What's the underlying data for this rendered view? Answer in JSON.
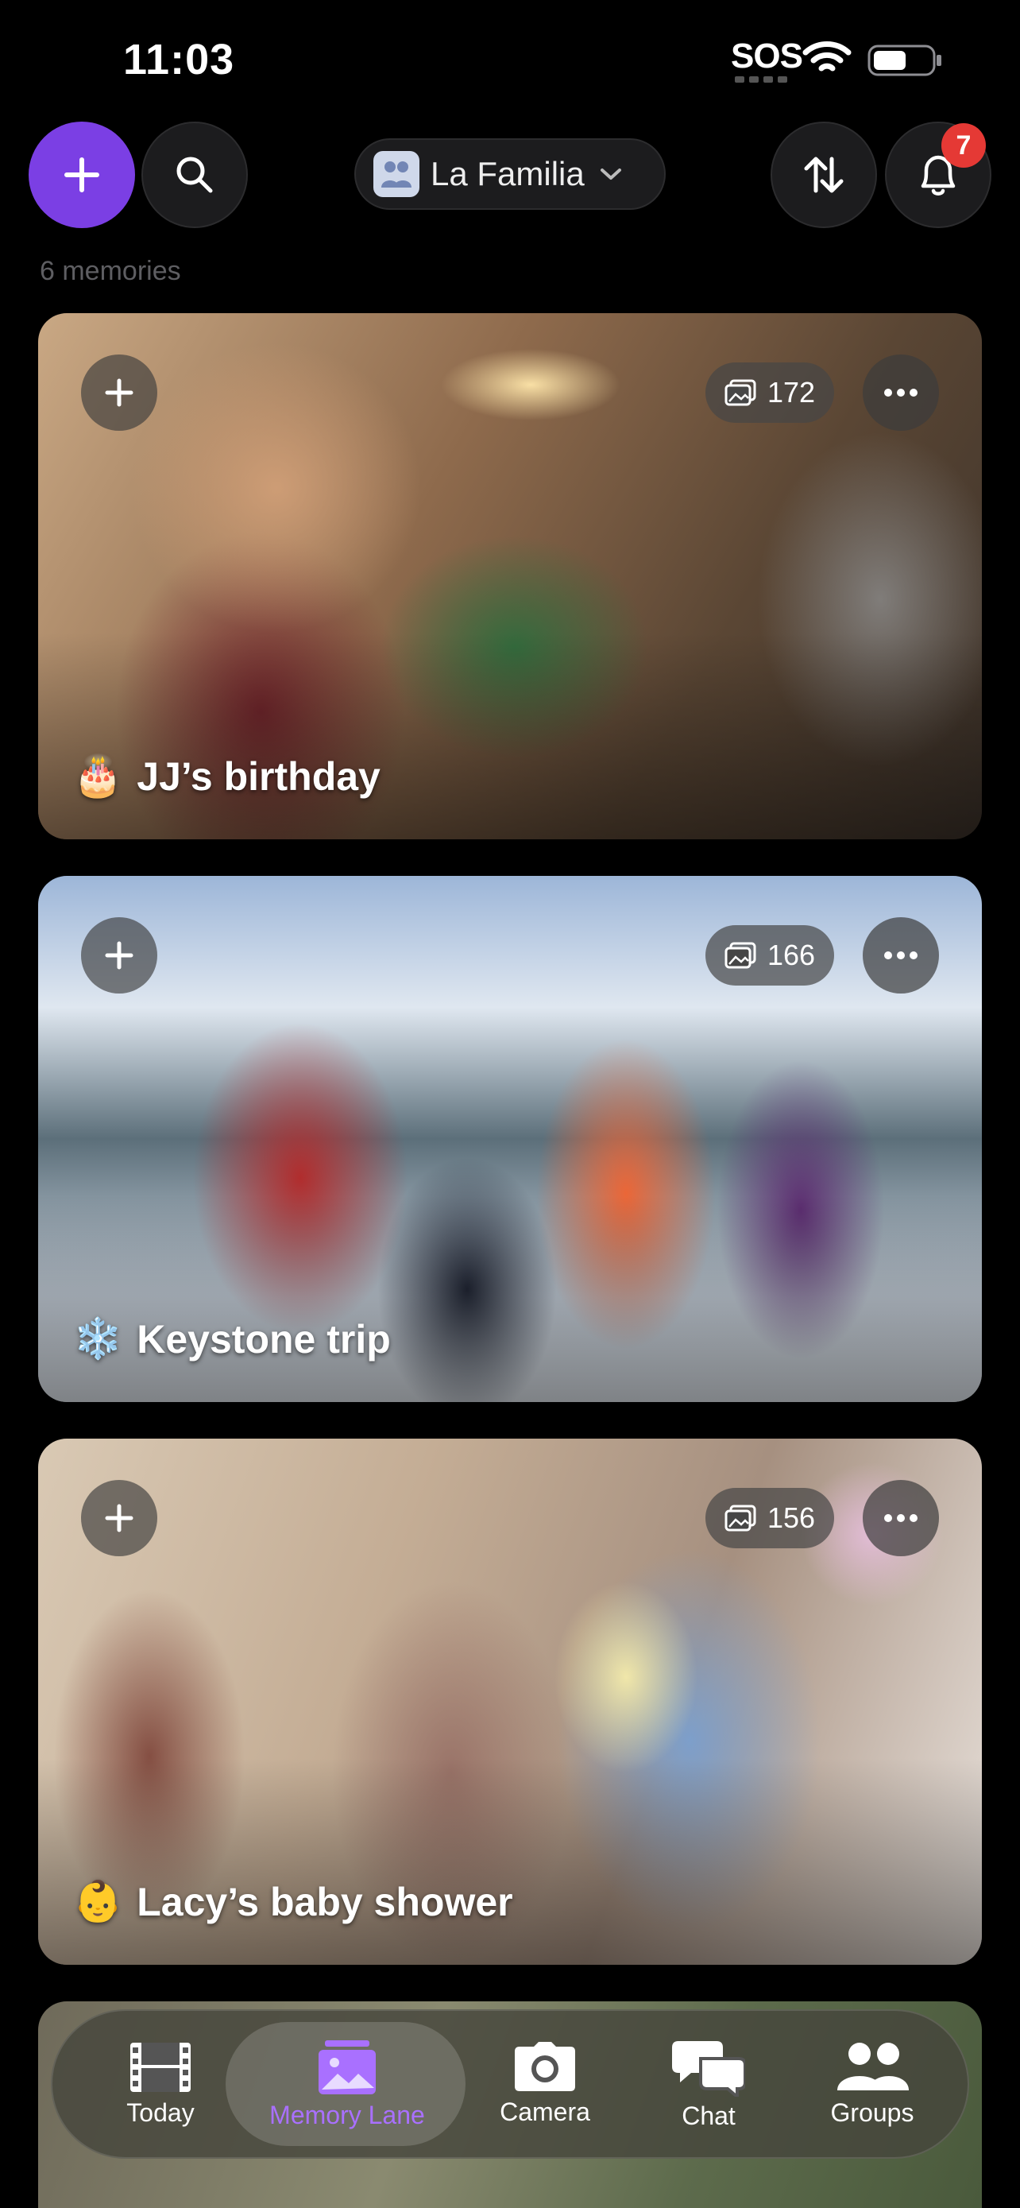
{
  "status_bar": {
    "time": "11:03",
    "sos": "SOS"
  },
  "header": {
    "group_name": "La Familia",
    "notification_count": "7"
  },
  "memory_count": "6 memories",
  "memories": [
    {
      "emoji": "🎂",
      "title": "JJ’s birthday",
      "photo_count": "172"
    },
    {
      "emoji": "❄️",
      "title": "Keystone trip",
      "photo_count": "166"
    },
    {
      "emoji": "👶",
      "title": "Lacy’s baby shower",
      "photo_count": "156"
    }
  ],
  "nav": {
    "items": [
      {
        "label": "Today",
        "icon": "film-icon"
      },
      {
        "label": "Memory Lane",
        "icon": "photo-stack-icon",
        "active": true
      },
      {
        "label": "Camera",
        "icon": "camera-icon"
      },
      {
        "label": "Chat",
        "icon": "chat-icon"
      },
      {
        "label": "Groups",
        "icon": "people-icon"
      }
    ]
  },
  "colors": {
    "accent": "#7b3fe4",
    "active_nav": "#a970ff",
    "badge": "#e53935"
  }
}
